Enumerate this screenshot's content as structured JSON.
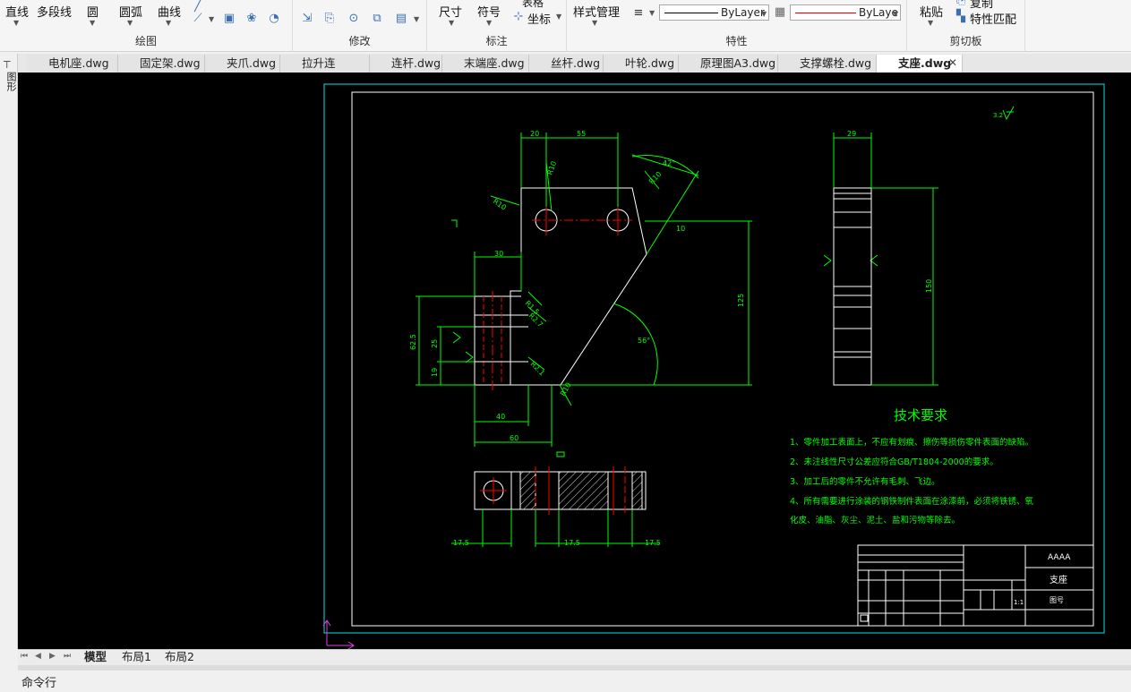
{
  "ribbon": {
    "draw": {
      "line": "直线",
      "polyline": "多段线",
      "circle": "圆",
      "arc": "圆弧",
      "curve": "曲线",
      "label": "绘图"
    },
    "modify": {
      "label": "修改"
    },
    "annotate": {
      "dimension": "尺寸",
      "symbol": "符号",
      "table": "表格",
      "coordinate": "坐标",
      "label": "标注"
    },
    "properties": {
      "style_manager": "样式管理",
      "linetype": "ByLayer",
      "lineweight": "ByLaye",
      "label": "特性"
    },
    "clipboard": {
      "paste": "粘贴",
      "copy": "复制",
      "match": "特性匹配",
      "label": "剪切板"
    }
  },
  "tabs": [
    {
      "label": "电机座.dwg"
    },
    {
      "label": "固定架.dwg"
    },
    {
      "label": "夹爪.dwg"
    },
    {
      "label": "拉升连杆.dwg"
    },
    {
      "label": "连杆.dwg"
    },
    {
      "label": "末端座.dwg"
    },
    {
      "label": "丝杆.dwg"
    },
    {
      "label": "叶轮.dwg"
    },
    {
      "label": "原理图A3.dwg"
    },
    {
      "label": "支撑螺栓.dwg"
    },
    {
      "label": "支座.dwg",
      "active": true
    }
  ],
  "left_strip": {
    "label": "图形"
  },
  "drawing": {
    "dims": {
      "d20": "20",
      "d55": "55",
      "r10a": "R10",
      "r10b": "R10",
      "r10c": "R10",
      "a42": "42°",
      "d10": "10",
      "d30": "30",
      "d125": "125",
      "a56": "56°",
      "r15": "R1.5",
      "r27": "R2.7",
      "r21": "R2.1",
      "r10d": "R10",
      "d62_5": "62.5",
      "d25": "25",
      "d19": "19",
      "d40": "40",
      "d60": "60",
      "d29": "29",
      "d150": "150",
      "s17_5a": "17.5",
      "s17_5b": "17.5",
      "s17_5c": "17.5"
    },
    "tech": {
      "title": "技术要求",
      "line1": "1、零件加工表面上，不应有划痕、擦伤等损伤零件表面的缺陷。",
      "line2": "2、未注线性尺寸公差应符合GB/T1804-2000的要求。",
      "line3": "3、加工后的零件不允许有毛刺、飞边。",
      "line4": "4、所有需要进行涂装的钢铁制件表面在涂漆前，必须将铁锈、氧",
      "line5": "化皮、油脂、灰尘、泥土、盐和污物等除去。"
    },
    "titleblock": {
      "company": "AAAA",
      "part_name": "支座",
      "drawing_no": "图号",
      "scale": "1:1"
    }
  },
  "layouts": {
    "model": "模型",
    "layout1": "布局1",
    "layout2": "布局2"
  },
  "command": {
    "label": "命令行"
  },
  "colors": {
    "canvas": "#000000",
    "frame": "#ffffff",
    "border": "#00e5e5",
    "dim": "#00ff00",
    "center": "#ff0000",
    "text": "#00ff00"
  }
}
